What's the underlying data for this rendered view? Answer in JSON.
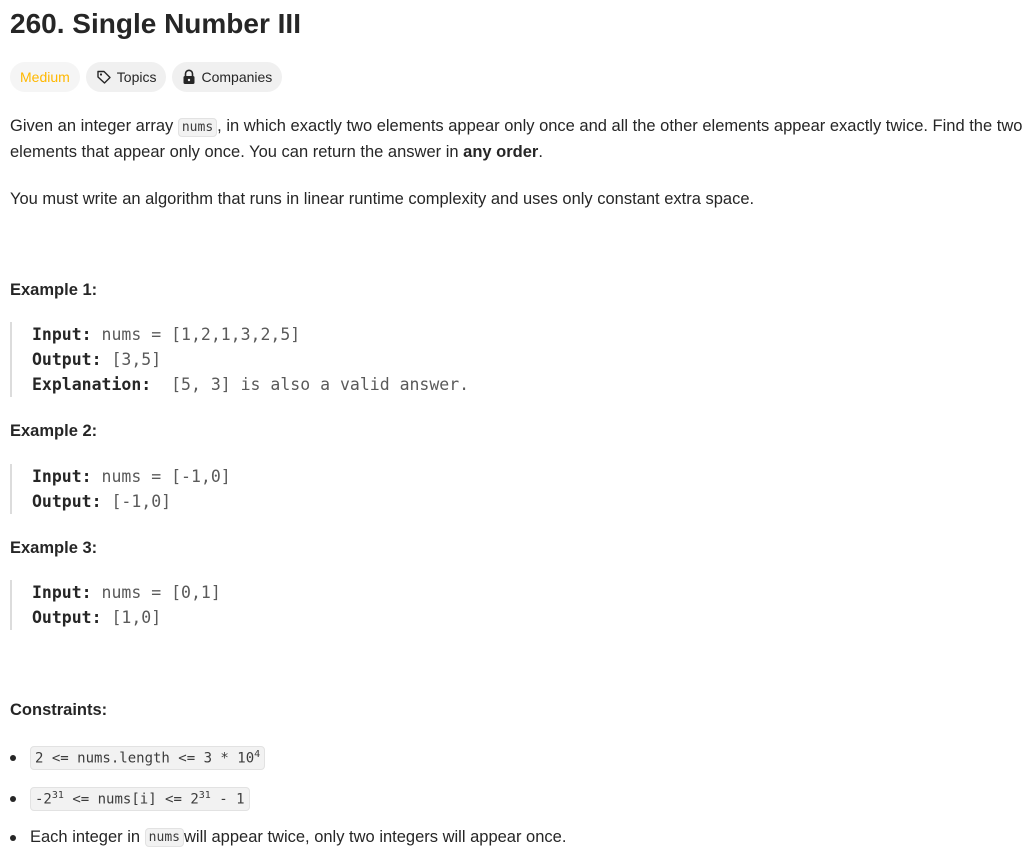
{
  "problem": {
    "title": "260. Single Number III",
    "difficulty": "Medium",
    "topics_label": "Topics",
    "companies_label": "Companies"
  },
  "description": {
    "p1_part1": "Given an integer array ",
    "p1_code": "nums",
    "p1_part2": ", in which exactly two elements appear only once and all the other elements appear exactly twice. Find the two elements that appear only once. You can return the answer in ",
    "p1_bold": "any order",
    "p1_part3": ".",
    "p2": "You must write an algorithm that runs in linear runtime complexity and uses only constant extra space."
  },
  "examples": [
    {
      "heading": "Example 1:",
      "input_label": "Input:",
      "input": " nums = [1,2,1,3,2,5]",
      "output_label": "Output:",
      "output": " [3,5]",
      "explanation_label": "Explanation:",
      "explanation": "  [5, 3] is also a valid answer."
    },
    {
      "heading": "Example 2:",
      "input_label": "Input:",
      "input": " nums = [-1,0]",
      "output_label": "Output:",
      "output": " [-1,0]"
    },
    {
      "heading": "Example 3:",
      "input_label": "Input:",
      "input": " nums = [0,1]",
      "output_label": "Output:",
      "output": " [1,0]"
    }
  ],
  "constraints": {
    "heading": "Constraints:",
    "c1_base": "2 <= nums.length <= 3 * 10",
    "c1_sup": "4",
    "c2_a": "-2",
    "c2_sup1": "31",
    "c2_b": " <= nums[i] <= 2",
    "c2_sup2": "31",
    "c2_c": " - 1",
    "c3_part1": "Each integer in ",
    "c3_code": "nums",
    "c3_part2": " will appear twice, only two integers will appear once."
  },
  "colors": {
    "medium": "#ffb800",
    "text": "#262626",
    "tag_bg": "#f0f0f0"
  },
  "icons": {
    "topics": "tag-icon",
    "companies": "lock-icon"
  }
}
